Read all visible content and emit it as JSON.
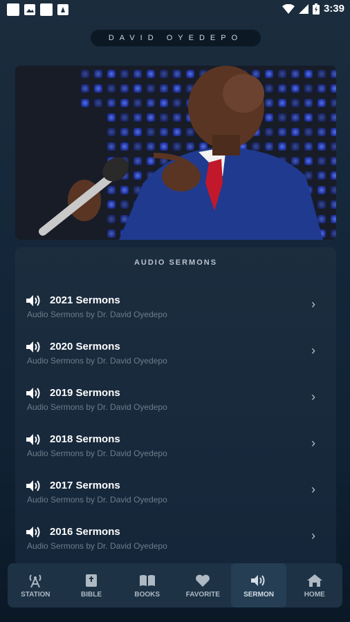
{
  "statusbar": {
    "time": "3:39"
  },
  "header": {
    "title": "DAVID OYEDEPO"
  },
  "hero": {
    "description_alt": "Preacher holding microphone"
  },
  "section": {
    "title": "AUDIO SERMONS",
    "items": [
      {
        "name": "2021 Sermons",
        "subtitle": "Audio Sermons by Dr. David Oyedepo"
      },
      {
        "name": "2020 Sermons",
        "subtitle": "Audio Sermons by Dr. David Oyedepo"
      },
      {
        "name": "2019 Sermons",
        "subtitle": "Audio Sermons by Dr. David Oyedepo"
      },
      {
        "name": "2018 Sermons",
        "subtitle": "Audio Sermons by Dr. David Oyedepo"
      },
      {
        "name": "2017 Sermons",
        "subtitle": "Audio Sermons by Dr. David Oyedepo"
      },
      {
        "name": "2016 Sermons",
        "subtitle": "Audio Sermons by Dr. David Oyedepo"
      }
    ]
  },
  "nav": {
    "items": [
      {
        "label": "STATION",
        "icon": "radio-tower-icon"
      },
      {
        "label": "BIBLE",
        "icon": "bible-icon"
      },
      {
        "label": "BOOKS",
        "icon": "book-open-icon"
      },
      {
        "label": "FAVORITE",
        "icon": "heart-icon"
      },
      {
        "label": "SERMON",
        "icon": "speaker-icon",
        "active": true
      },
      {
        "label": "HOME",
        "icon": "home-icon"
      }
    ]
  },
  "colors": {
    "accent": "#253e54",
    "background": "#14273a"
  }
}
